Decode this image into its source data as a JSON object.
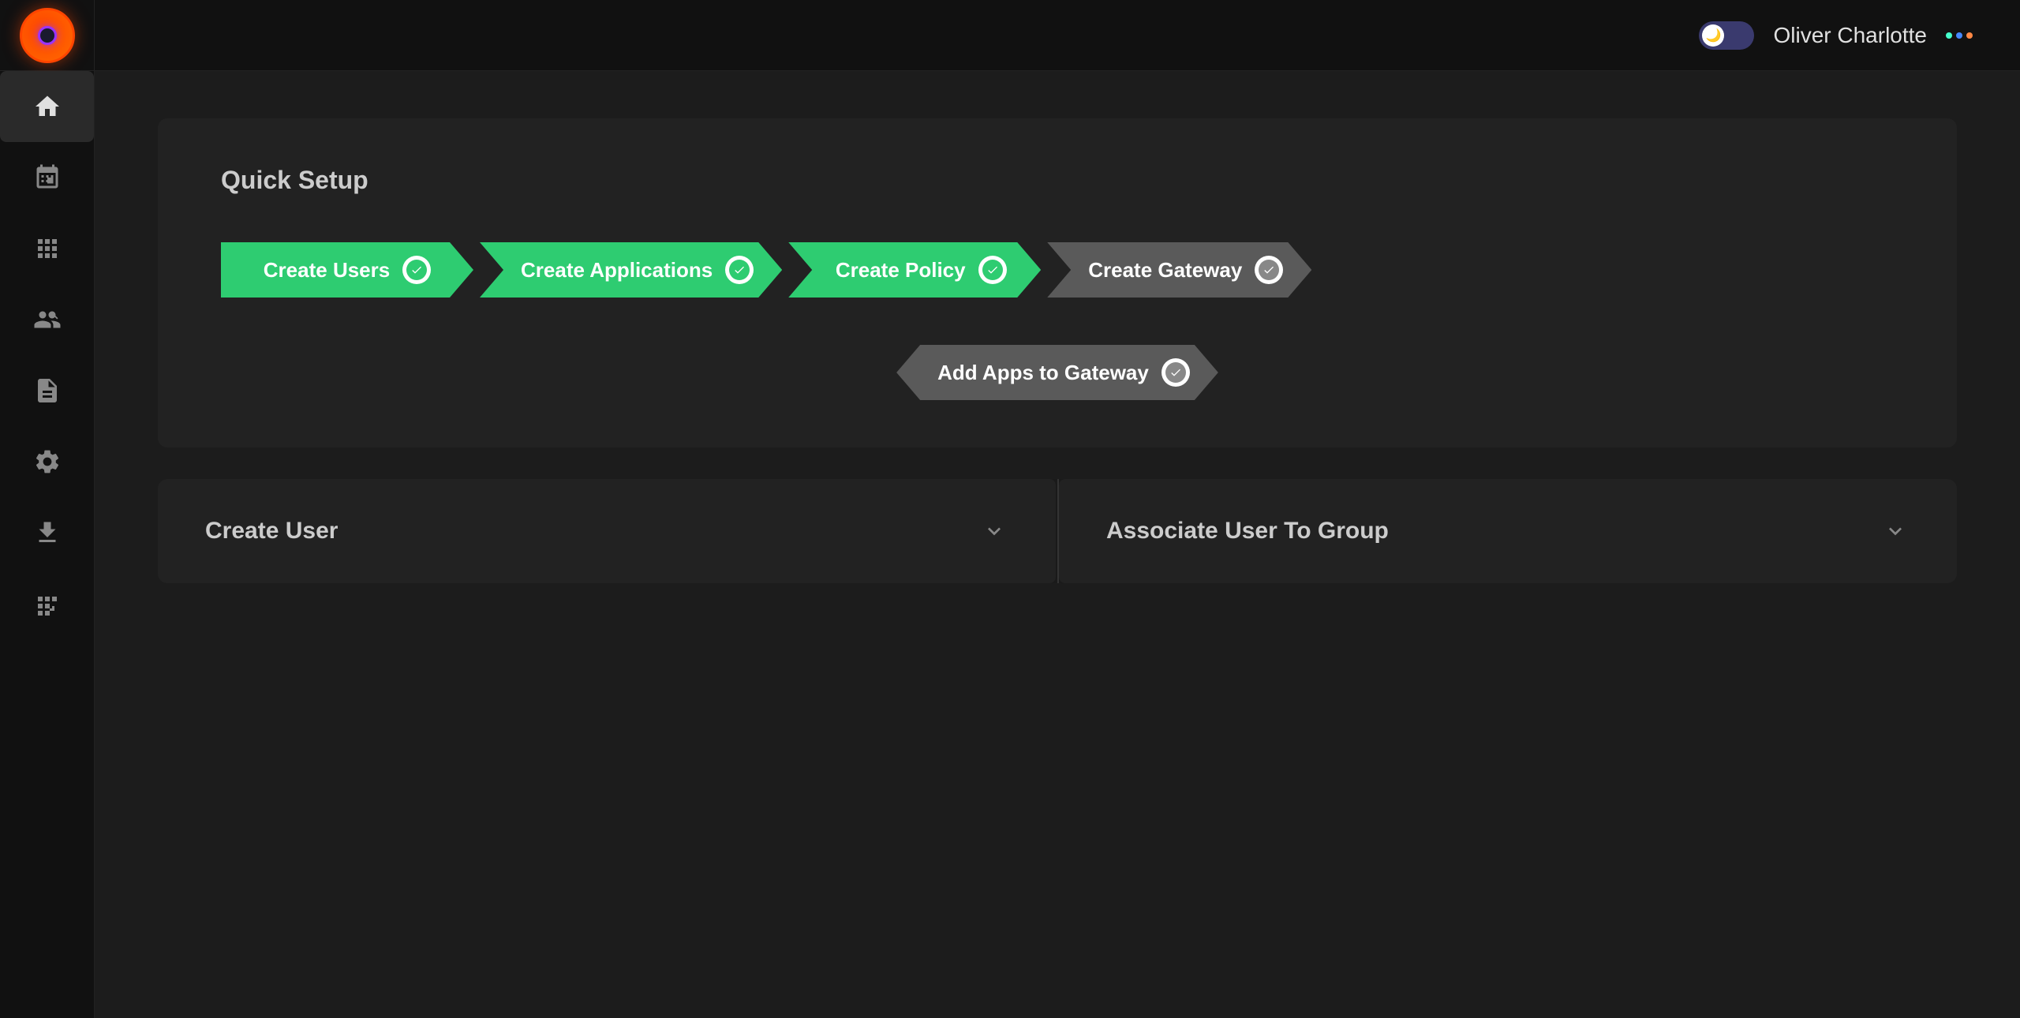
{
  "topbar": {
    "username": "Oliver Charlotte"
  },
  "sidebar": {
    "logo_alt": "App Logo",
    "items": [
      {
        "name": "home",
        "label": "Home",
        "active": true
      },
      {
        "name": "users",
        "label": "Users",
        "active": false
      },
      {
        "name": "apps",
        "label": "Applications",
        "active": false
      },
      {
        "name": "identity",
        "label": "Identity",
        "active": false
      },
      {
        "name": "policies",
        "label": "Policies",
        "active": false
      },
      {
        "name": "settings",
        "label": "Settings",
        "active": false
      },
      {
        "name": "downloads",
        "label": "Downloads",
        "active": false
      },
      {
        "name": "integrations",
        "label": "Integrations",
        "active": false
      }
    ]
  },
  "quick_setup": {
    "title": "Quick Setup",
    "steps": [
      {
        "label": "Create Users",
        "status": "green",
        "checked": true,
        "is_first": true
      },
      {
        "label": "Create Applications",
        "status": "green",
        "checked": true,
        "is_first": false
      },
      {
        "label": "Create Policy",
        "status": "green",
        "checked": true,
        "is_first": false
      },
      {
        "label": "Create Gateway",
        "status": "gray",
        "checked": true,
        "is_first": false
      }
    ],
    "step2": {
      "label": "Add Apps to Gateway",
      "status": "gray",
      "checked": true
    }
  },
  "panels": {
    "create_user": {
      "title": "Create User"
    },
    "associate_user": {
      "title": "Associate User To Group"
    }
  },
  "icons": {
    "check": "✓",
    "chevron_down": "chevron-down"
  }
}
